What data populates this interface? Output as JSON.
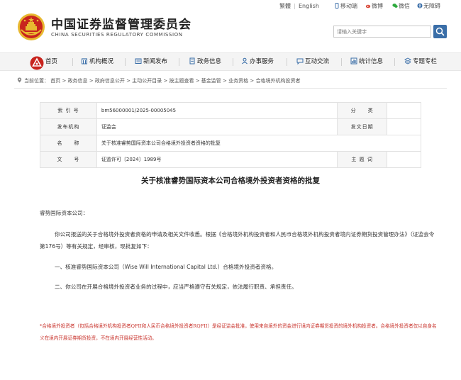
{
  "top_links": {
    "traditional": "繁體",
    "english": "English",
    "mobile": "移动端",
    "weibo": "微博",
    "wechat": "微信",
    "accessibility": "无障碍"
  },
  "header": {
    "title_cn": "中国证券监督管理委员会",
    "title_en": "CHINA SECURITIES REGULATORY COMMISSION",
    "search_placeholder": "请输入关键字"
  },
  "nav": {
    "items": [
      {
        "label": "首页",
        "icon": "home-icon"
      },
      {
        "label": "机构概况",
        "icon": "building-icon"
      },
      {
        "label": "新闻发布",
        "icon": "news-icon"
      },
      {
        "label": "政务信息",
        "icon": "document-icon"
      },
      {
        "label": "办事服务",
        "icon": "service-icon"
      },
      {
        "label": "互动交流",
        "icon": "chat-icon"
      },
      {
        "label": "统计信息",
        "icon": "chart-icon"
      },
      {
        "label": "专题专栏",
        "icon": "topic-icon"
      }
    ]
  },
  "breadcrumb": {
    "prefix": "当前位置：",
    "path": "首页 > 政务信息 > 政府信息公开 > 主动公开目录 > 按主题查看 > 基金监管 > 业务资格 > 合格境外机构投资者"
  },
  "meta": {
    "index_label": "索 引 号",
    "index_value": "bm56000001/2025-00005045",
    "category_label": "分　　类",
    "category_value": "",
    "agency_label": "发布机构",
    "agency_value": "证监会",
    "date_label": "发文日期",
    "date_value": "",
    "name_label": "名　　称",
    "name_value": "关于核准睿势国际资本公司合格境外投资者资格的批复",
    "doc_no_label": "文　　号",
    "doc_no_value": "证监许可〔2024〕1989号",
    "keywords_label": "主 题 词",
    "keywords_value": ""
  },
  "article": {
    "title": "关于核准睿势国际资本公司合格境外投资者资格的批复",
    "addressee": "睿势国际资本公司：",
    "para1": "你公司报送的关于合格境外投资者资格的申请及相关文件收悉。根据《合格境外机构投资者和人民币合格境外机构投资者境内证券期货投资管理办法》（证监会令第176号）等有关规定，经审核，现批复如下：",
    "para2": "一、核准睿势国际资本公司（Wise Will International Capital Ltd.）合格境外投资者资格。",
    "para3": "二、你公司在开展合格境外投资者业务的过程中，应当严格遵守有关规定，依法履行职责、承担责任。",
    "note": "*合格境外投资者（包括合格境外机构投资者QFII和人民币合格境外投资者RQFII）是经证监会批准，使用来自境外的资金进行境内证券期货投资的境外机构投资者。合格境外投资者仅以自身名义在境内开展证券期货投资，不在境内开展经营性活动。"
  },
  "colors": {
    "brand_blue": "#3a6ea8",
    "emblem_red": "#c8241e",
    "emblem_gold": "#e8b830",
    "note_red": "#c8322b"
  }
}
